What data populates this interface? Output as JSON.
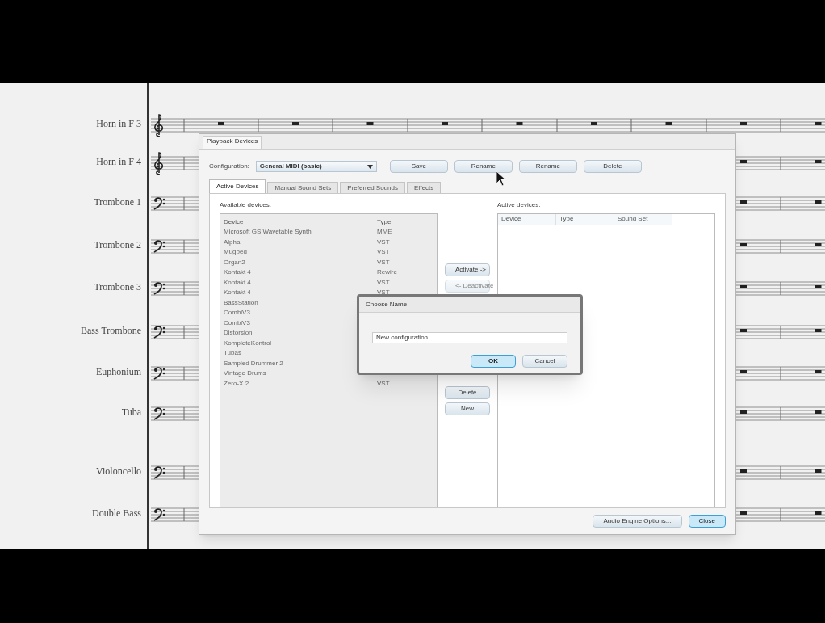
{
  "score": {
    "staves": [
      {
        "name": "Horn in F 3",
        "kind": "treble"
      },
      {
        "name": "Horn in F 4",
        "kind": "treble"
      },
      {
        "name": "Trombone 1",
        "kind": "bass"
      },
      {
        "name": "Trombone 2",
        "kind": "bass"
      },
      {
        "name": "Trombone 3",
        "kind": "bass"
      },
      {
        "name": "Bass Trombone",
        "kind": "bass"
      },
      {
        "name": "Euphonium",
        "kind": "bass"
      },
      {
        "name": "Tuba",
        "kind": "bass"
      },
      {
        "name": "Violoncello",
        "kind": "bass"
      },
      {
        "name": "Double Bass",
        "kind": "bass"
      }
    ]
  },
  "dialog": {
    "title": "Playback Devices",
    "configuration_label": "Configuration:",
    "configuration": "General MIDI (basic)",
    "config_buttons": [
      "Save",
      "Rename",
      "Rename",
      "Delete"
    ],
    "tabs": [
      {
        "label": "Active Devices",
        "selected": true
      },
      {
        "label": "Manual Sound Sets",
        "selected": false
      },
      {
        "label": "Preferred Sounds",
        "selected": false
      },
      {
        "label": "Effects",
        "selected": false
      }
    ],
    "available": {
      "label": "Available devices:",
      "columns": [
        "Device",
        "Type"
      ],
      "rows": [
        [
          "Microsoft GS Wavetable Synth",
          "MME"
        ],
        [
          "Alpha",
          "VST"
        ],
        [
          "Mugbed",
          "VST"
        ],
        [
          "Organ2",
          "VST"
        ],
        [
          "Kontakt 4",
          "Rewire"
        ],
        [
          "Kontakt 4",
          "VST"
        ],
        [
          "Kontakt 4",
          "VST"
        ],
        [
          "BassStation",
          ""
        ],
        [
          "CombiV3",
          ""
        ],
        [
          "CombiV3",
          ""
        ],
        [
          "Distorsion",
          ""
        ],
        [
          "KompleteKontrol",
          ""
        ],
        [
          "Tubas",
          ""
        ],
        [
          "Sampled Drummer 2",
          ""
        ],
        [
          "Vintage Drums",
          ""
        ],
        [
          "Zero-X 2",
          "VST"
        ]
      ]
    },
    "middle_buttons": [
      {
        "label": "Activate ->",
        "disabled": false
      },
      {
        "label": "<- Deactivate",
        "disabled": true
      },
      {
        "label": "Delete",
        "disabled": false
      },
      {
        "label": "New",
        "disabled": false
      }
    ],
    "active": {
      "label": "Active devices:",
      "columns": [
        "Device",
        "Type",
        "Sound Set"
      ]
    },
    "bottom_buttons": [
      {
        "label": "Audio Engine Options...",
        "default": false
      },
      {
        "label": "Close",
        "default": true
      }
    ]
  },
  "choose_name": {
    "title": "Choose Name",
    "value": "New configuration",
    "buttons": [
      {
        "label": "OK",
        "default": true
      },
      {
        "label": "Cancel",
        "default": false
      }
    ]
  }
}
